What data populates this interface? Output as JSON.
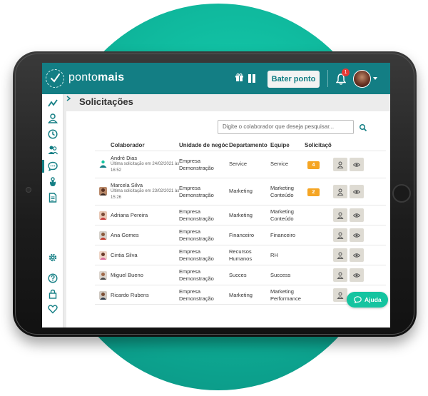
{
  "brand": {
    "name_regular": "ponto",
    "name_bold": "mais"
  },
  "topbar": {
    "clock_button": "Bater ponto",
    "notification_count": "1"
  },
  "page": {
    "title": "Solicitações"
  },
  "search": {
    "placeholder": "Digite o colaborador que deseja pesquisar..."
  },
  "table": {
    "headers": {
      "colaborador": "Colaborador",
      "unidade": "Unidade de negócio",
      "departamento": "Departamento",
      "equipe": "Equipe",
      "solicitacoes": "Solicitações"
    },
    "rows": [
      {
        "name": "André Dias",
        "note": "Última solicitação em 24/02/2021 às 16:52",
        "unidade": "Empresa Demonstração",
        "departamento": "Service",
        "equipe": "Service",
        "count": "4"
      },
      {
        "name": "Marcela Silva",
        "note": "Última solicitação em 23/02/2021 às 15:26",
        "unidade": "Empresa Demonstração",
        "departamento": "Marketing",
        "equipe": "Marketing Conteúdo",
        "count": "2"
      },
      {
        "name": "Adriana Pereira",
        "note": "",
        "unidade": "Empresa Demonstração",
        "departamento": "Marketing",
        "equipe": "Marketing Conteúdo",
        "count": ""
      },
      {
        "name": "Ana Gomes",
        "note": "",
        "unidade": "Empresa Demonstração",
        "departamento": "Financeiro",
        "equipe": "Financeiro",
        "count": ""
      },
      {
        "name": "Cintia Silva",
        "note": "",
        "unidade": "Empresa Demonstração",
        "departamento": "Recursos Humanos",
        "equipe": "RH",
        "count": ""
      },
      {
        "name": "Miguel Bueno",
        "note": "",
        "unidade": "Empresa Demonstração",
        "departamento": "Succes",
        "equipe": "Success",
        "count": ""
      },
      {
        "name": "Ricardo Rubens",
        "note": "",
        "unidade": "Empresa Demonstração",
        "departamento": "Marketing",
        "equipe": "Marketing Performance",
        "count": ""
      }
    ]
  },
  "help": {
    "label": "Ajuda"
  },
  "colors": {
    "brand_teal": "#137e84",
    "accent_green": "#14c4a0",
    "badge_orange": "#f5a524",
    "notification_red": "#e53935"
  },
  "icons": {
    "sidebar": [
      "chart-line-icon",
      "user-icon",
      "clock-icon",
      "users-icon",
      "chat-icon",
      "hand-icon",
      "document-icon",
      "gear-icon",
      "help-icon",
      "lock-icon",
      "heart-icon"
    ],
    "topbar": [
      "gift-icon",
      "pause-icon",
      "bell-icon"
    ],
    "row_actions": [
      "user-icon",
      "eye-icon"
    ]
  }
}
